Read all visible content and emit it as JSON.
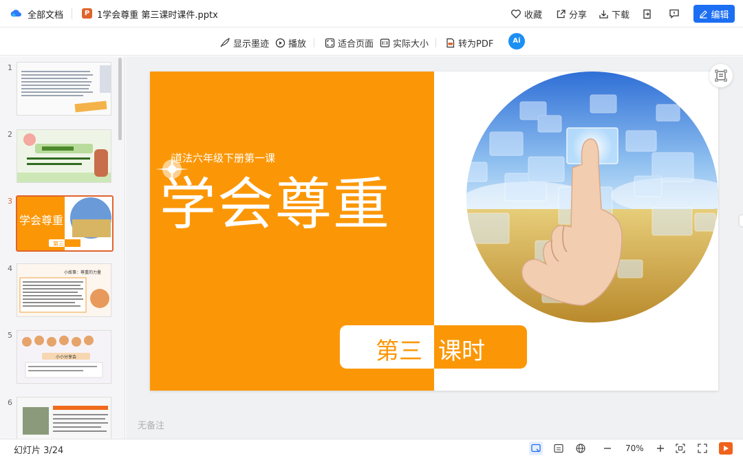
{
  "header": {
    "all_docs": "全部文档",
    "ppt_badge": "P",
    "filename": "1学会尊重 第三课时课件.pptx",
    "favorite": "收藏",
    "share": "分享",
    "download": "下载",
    "edit": "编辑"
  },
  "toolbar": {
    "show_ink": "显示墨迹",
    "play": "播放",
    "fit_page": "适合页面",
    "actual_size": "实际大小",
    "to_pdf": "转为PDF",
    "ai": "Ai"
  },
  "thumbnails": {
    "numbers": [
      "1",
      "2",
      "3",
      "4",
      "5",
      "6"
    ],
    "active_index": 3,
    "t3_title": "学会尊重",
    "t3_badge": "第三课时",
    "t4_title": "小故事：尊重的力量",
    "t5_title": "小小分享会"
  },
  "slide": {
    "subtitle": "道法六年级下册第一课",
    "title": "学会尊重",
    "lesson_part1": "第三",
    "lesson_part2": "课时",
    "accent_color": "#fb9707"
  },
  "notes": "无备注",
  "status": {
    "slide_count": "幻灯片 3/24",
    "zoom": "70%"
  }
}
